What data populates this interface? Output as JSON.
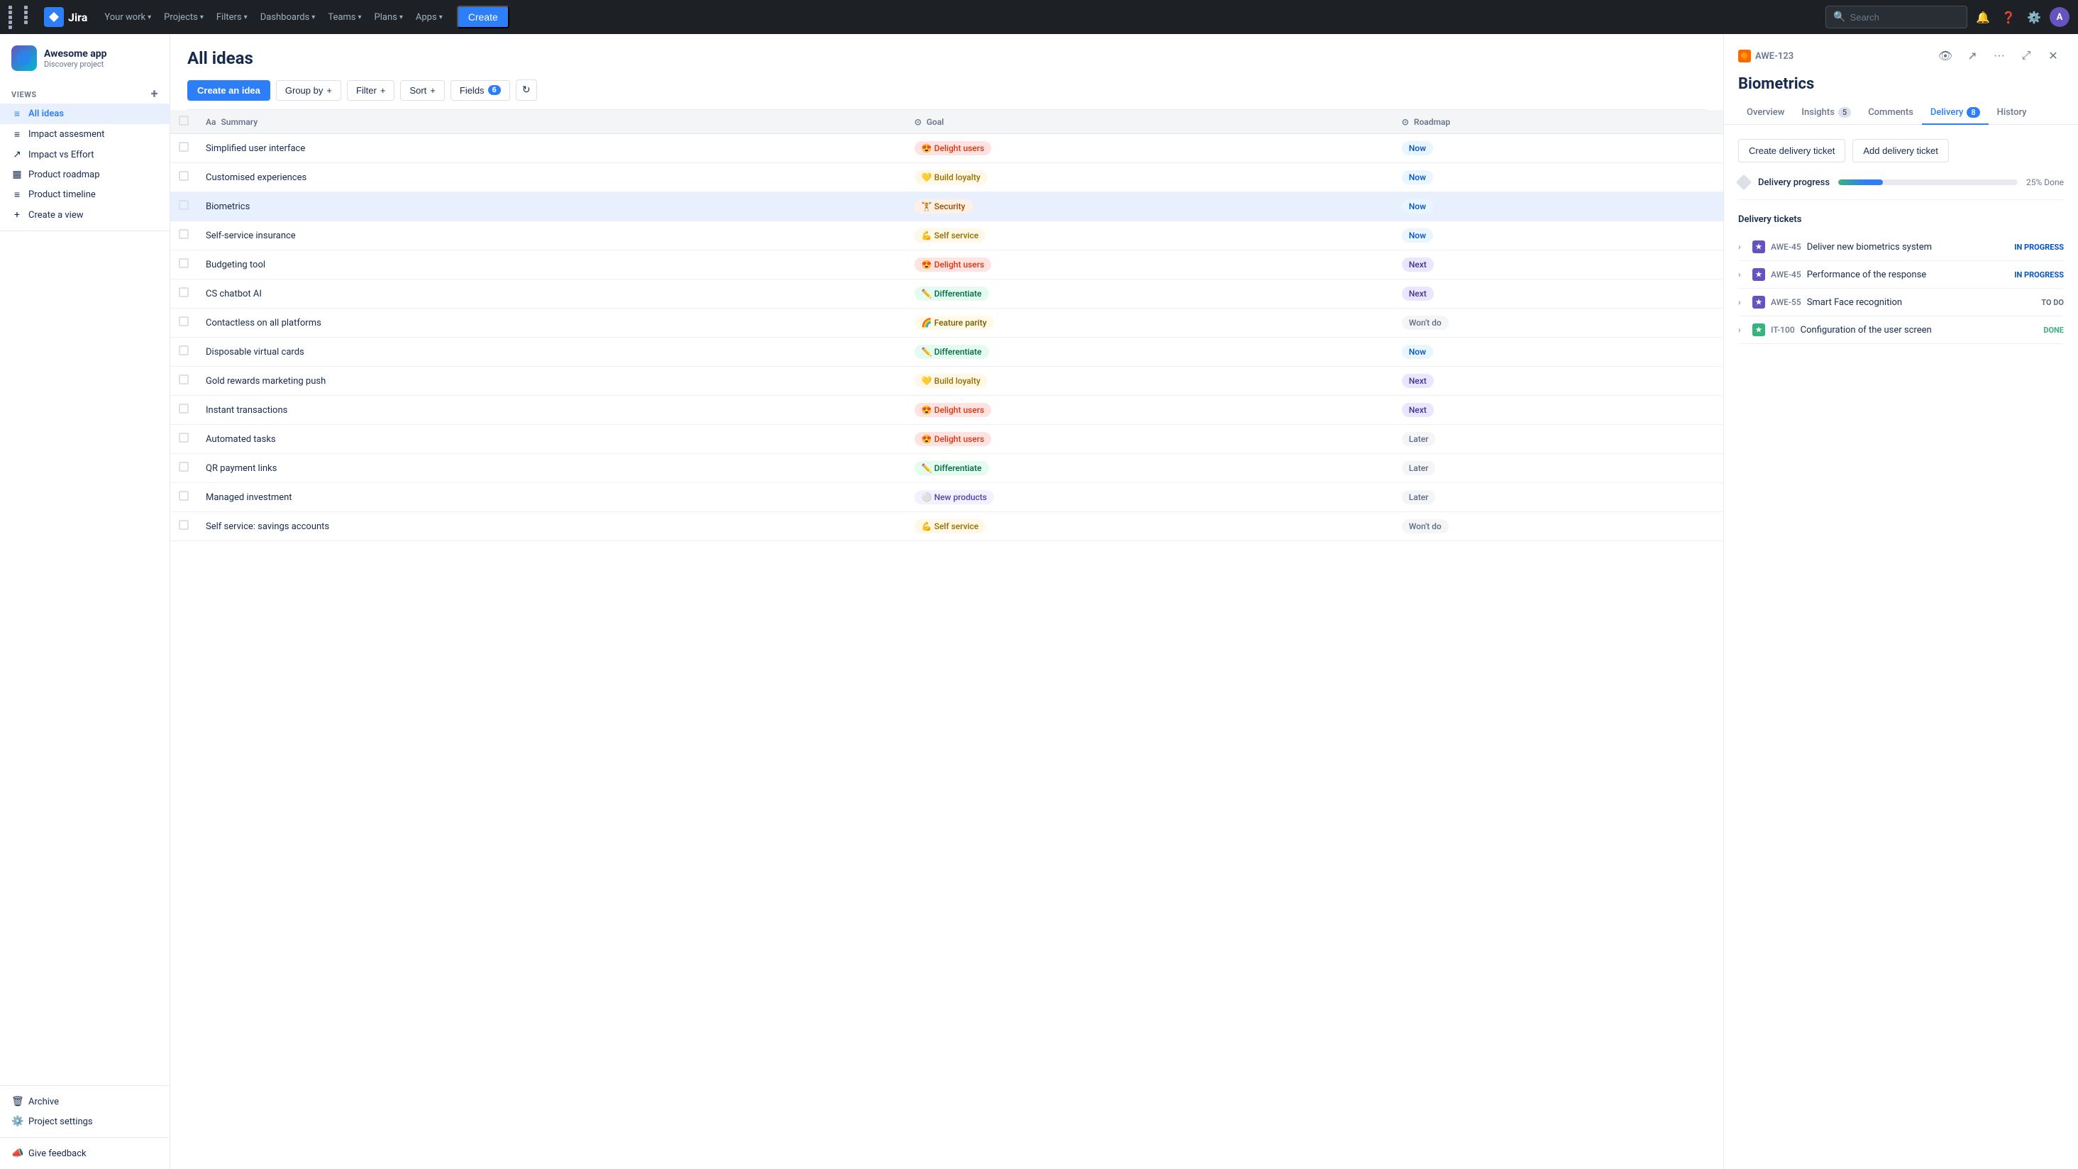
{
  "topnav": {
    "logo_text": "Jira",
    "links": [
      {
        "label": "Your work",
        "id": "your-work"
      },
      {
        "label": "Projects",
        "id": "projects"
      },
      {
        "label": "Filters",
        "id": "filters"
      },
      {
        "label": "Dashboards",
        "id": "dashboards"
      },
      {
        "label": "Teams",
        "id": "teams"
      },
      {
        "label": "Plans",
        "id": "plans"
      },
      {
        "label": "Apps",
        "id": "apps"
      }
    ],
    "create_label": "Create",
    "search_placeholder": "Search"
  },
  "sidebar": {
    "app_name": "Awesome app",
    "app_sub": "Discovery project",
    "views_label": "VIEWS",
    "items": [
      {
        "label": "All ideas",
        "id": "all-ideas",
        "icon": "≡",
        "active": true
      },
      {
        "label": "Impact assesment",
        "id": "impact-assesment",
        "icon": "≡"
      },
      {
        "label": "Impact vs Effort",
        "id": "impact-effort",
        "icon": "↗"
      },
      {
        "label": "Product roadmap",
        "id": "product-roadmap",
        "icon": "▦"
      },
      {
        "label": "Product timeline",
        "id": "product-timeline",
        "icon": "≡"
      },
      {
        "label": "Create a view",
        "id": "create-view",
        "icon": "+"
      }
    ],
    "archive_label": "Archive",
    "settings_label": "Project settings",
    "feedback_label": "Give feedback"
  },
  "ideas": {
    "title": "All ideas",
    "toolbar": {
      "create_label": "Create an idea",
      "groupby_label": "Group by",
      "filter_label": "Filter",
      "sort_label": "Sort",
      "fields_label": "Fields",
      "fields_count": "6"
    },
    "columns": [
      {
        "label": "Summary",
        "icon": "Aa",
        "id": "summary"
      },
      {
        "label": "Goal",
        "icon": "⊙",
        "id": "goal"
      },
      {
        "label": "Roadmap",
        "icon": "⊙",
        "id": "roadmap"
      }
    ],
    "rows": [
      {
        "id": 1,
        "summary": "Simplified user interface",
        "goal": "Delight users",
        "goal_class": "goal-delight",
        "goal_emoji": "😍",
        "roadmap": "Now",
        "roadmap_class": "roadmap-now",
        "active": false
      },
      {
        "id": 2,
        "summary": "Customised experiences",
        "goal": "Build loyalty",
        "goal_class": "goal-loyalty",
        "goal_emoji": "💛",
        "roadmap": "Now",
        "roadmap_class": "roadmap-now",
        "active": false
      },
      {
        "id": 3,
        "summary": "Biometrics",
        "goal": "Security",
        "goal_class": "goal-security",
        "goal_emoji": "🏋",
        "roadmap": "Now",
        "roadmap_class": "roadmap-now",
        "active": true
      },
      {
        "id": 4,
        "summary": "Self-service insurance",
        "goal": "Self service",
        "goal_class": "goal-selfservice",
        "goal_emoji": "💪",
        "roadmap": "Now",
        "roadmap_class": "roadmap-now",
        "active": false
      },
      {
        "id": 5,
        "summary": "Budgeting tool",
        "goal": "Delight users",
        "goal_class": "goal-delight",
        "goal_emoji": "😍",
        "roadmap": "Next",
        "roadmap_class": "roadmap-next",
        "active": false
      },
      {
        "id": 6,
        "summary": "CS chatbot AI",
        "goal": "Differentiate",
        "goal_class": "goal-differentiate",
        "goal_emoji": "✏️",
        "roadmap": "Next",
        "roadmap_class": "roadmap-next",
        "active": false
      },
      {
        "id": 7,
        "summary": "Contactless on all platforms",
        "goal": "Feature parity",
        "goal_class": "goal-featureparity",
        "goal_emoji": "🌈",
        "roadmap": "Won't do",
        "roadmap_class": "roadmap-wontdo",
        "active": false
      },
      {
        "id": 8,
        "summary": "Disposable virtual cards",
        "goal": "Differentiate",
        "goal_class": "goal-differentiate",
        "goal_emoji": "✏️",
        "roadmap": "Now",
        "roadmap_class": "roadmap-now",
        "active": false
      },
      {
        "id": 9,
        "summary": "Gold rewards marketing push",
        "goal": "Build loyalty",
        "goal_class": "goal-loyalty",
        "goal_emoji": "💛",
        "roadmap": "Next",
        "roadmap_class": "roadmap-next",
        "active": false
      },
      {
        "id": 10,
        "summary": "Instant transactions",
        "goal": "Delight users",
        "goal_class": "goal-delight",
        "goal_emoji": "😍",
        "roadmap": "Next",
        "roadmap_class": "roadmap-next",
        "active": false
      },
      {
        "id": 11,
        "summary": "Automated tasks",
        "goal": "Delight users",
        "goal_class": "goal-delight",
        "goal_emoji": "😍",
        "roadmap": "Later",
        "roadmap_class": "roadmap-later",
        "active": false
      },
      {
        "id": 12,
        "summary": "QR payment links",
        "goal": "Differentiate",
        "goal_class": "goal-differentiate",
        "goal_emoji": "✏️",
        "roadmap": "Later",
        "roadmap_class": "roadmap-later",
        "active": false
      },
      {
        "id": 13,
        "summary": "Managed investment",
        "goal": "New products",
        "goal_class": "goal-newproducts",
        "goal_emoji": "⚪",
        "roadmap": "Later",
        "roadmap_class": "roadmap-later",
        "active": false
      },
      {
        "id": 14,
        "summary": "Self service: savings accounts",
        "goal": "Self service",
        "goal_class": "goal-selfservice",
        "goal_emoji": "💪",
        "roadmap": "Won't do",
        "roadmap_class": "roadmap-wontdo",
        "active": false
      }
    ]
  },
  "detail": {
    "ticket_id": "AWE-123",
    "title": "Biometrics",
    "tabs": [
      {
        "label": "Overview",
        "id": "overview",
        "active": false
      },
      {
        "label": "Insights",
        "id": "insights",
        "count": "5",
        "active": false
      },
      {
        "label": "Comments",
        "id": "comments",
        "active": false
      },
      {
        "label": "Delivery",
        "id": "delivery",
        "count": "8",
        "active": true
      },
      {
        "label": "History",
        "id": "history",
        "active": false
      }
    ],
    "delivery": {
      "create_ticket_label": "Create delivery ticket",
      "add_ticket_label": "Add delivery ticket",
      "progress_label": "Delivery progress",
      "progress_percent": 25,
      "progress_text": "25% Done",
      "tickets_label": "Delivery tickets",
      "tickets": [
        {
          "ticket_id": "AWE-45",
          "title": "Deliver new biometrics system",
          "status": "IN PROGRESS",
          "status_class": "status-inprogress",
          "type": "story",
          "type_class": "ticket-type-story"
        },
        {
          "ticket_id": "AWE-45",
          "title": "Performance of the response",
          "status": "IN PROGRESS",
          "status_class": "status-inprogress",
          "type": "story",
          "type_class": "ticket-type-story"
        },
        {
          "ticket_id": "AWE-55",
          "title": "Smart Face recognition",
          "status": "TO DO",
          "status_class": "status-todo",
          "type": "story",
          "type_class": "ticket-type-story"
        },
        {
          "ticket_id": "IT-100",
          "title": "Configuration of the user screen",
          "status": "DONE",
          "status_class": "status-done",
          "type": "task",
          "type_class": "ticket-type-task"
        }
      ]
    }
  }
}
